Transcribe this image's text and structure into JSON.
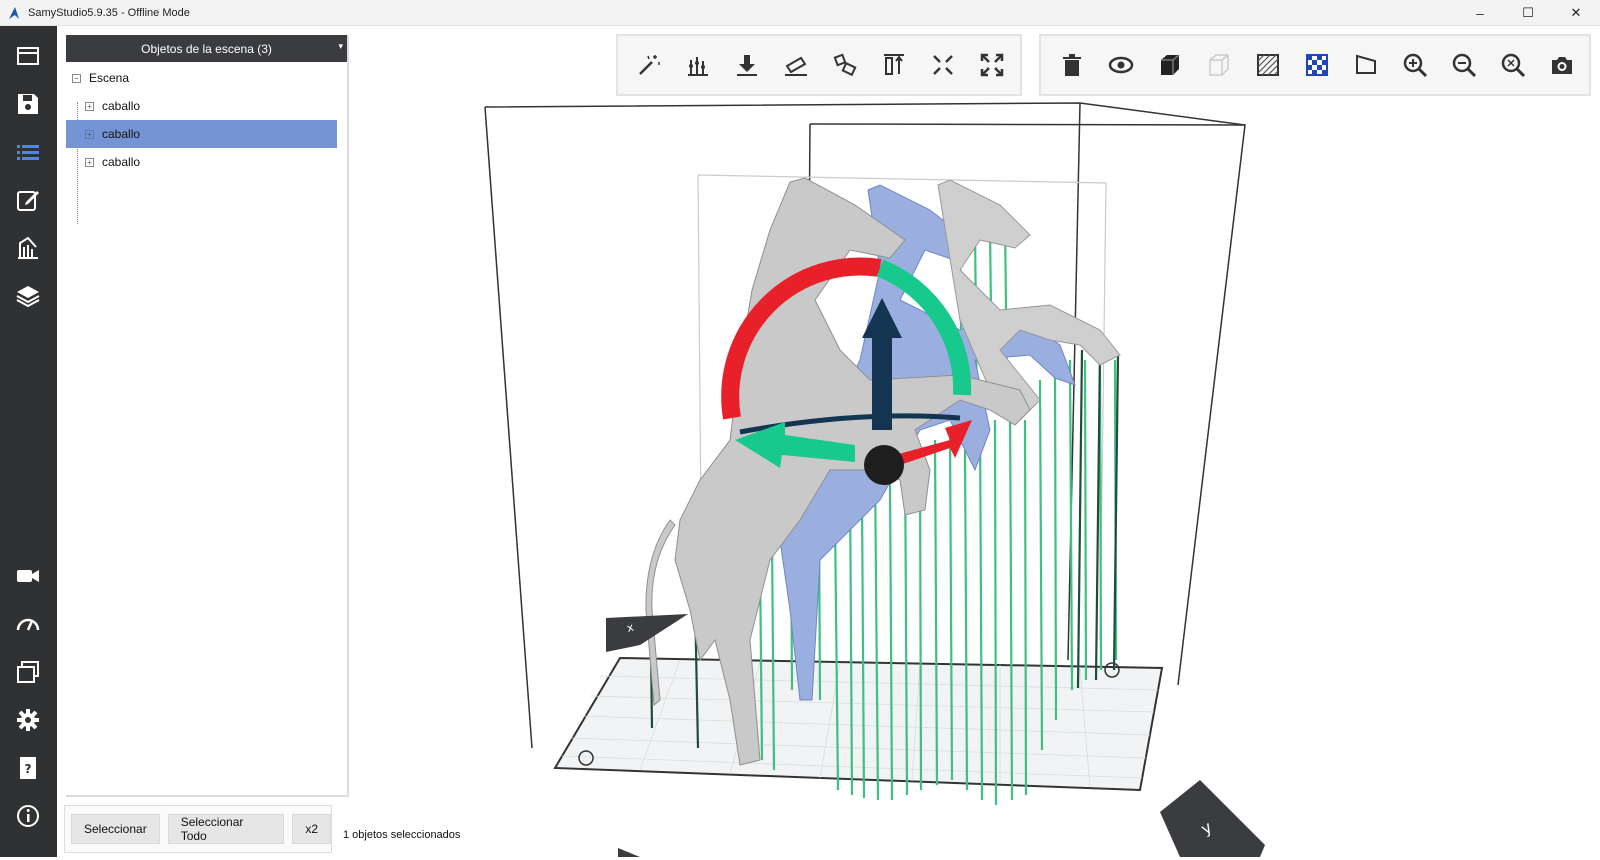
{
  "window": {
    "title": "SamyStudio5.9.35 - Offline Mode",
    "controls": [
      "–",
      "☐",
      "✕"
    ]
  },
  "sidebar": {
    "items": [
      {
        "name": "open-project-icon"
      },
      {
        "name": "save-icon"
      },
      {
        "name": "scene-list-icon",
        "active": true
      },
      {
        "name": "edit-icon"
      },
      {
        "name": "supports-icon"
      },
      {
        "name": "layers-icon"
      },
      {
        "name": "camera-icon"
      },
      {
        "name": "speed-gauge-icon"
      },
      {
        "name": "windows-icon"
      },
      {
        "name": "settings-gear-icon"
      },
      {
        "name": "help-manual-icon"
      },
      {
        "name": "info-icon"
      }
    ]
  },
  "scene_panel": {
    "header": "Objetos de la escena (3)",
    "root": "Escena",
    "objects": [
      "caballo",
      "caballo",
      "caballo"
    ],
    "selected_index": 1
  },
  "bottom": {
    "select_label": "Seleccionar",
    "select_all_label": "Seleccionar Todo",
    "x2_label": "x2",
    "status": "1 objetos seleccionados"
  },
  "toolbar_left": [
    "magic-wand-icon",
    "supports-bars-icon",
    "drop-to-plate-icon",
    "lay-flat-icon",
    "rotate-object-icon",
    "height-icon",
    "arrange-icon",
    "fit-screen-icon"
  ],
  "toolbar_right": [
    "delete-trash-icon",
    "view-eye-icon",
    "solid-cube-icon",
    "transparent-cube-icon",
    "hatch-view-icon",
    "checker-view-icon",
    "slice-flag-icon",
    "zoom-in-icon",
    "zoom-out-icon",
    "zoom-fit-icon",
    "screenshot-camera-icon"
  ],
  "colors": {
    "sidebar": "#2f3133",
    "panel_header": "#3a3c3f",
    "selection": "#7594d4",
    "support_green": "#3fbf82",
    "gizmo_red": "#e8202a",
    "gizmo_green": "#17c98c",
    "gizmo_navy": "#143552",
    "model_gray": "#c9c9c9",
    "model_blue": "#9aaee0"
  }
}
